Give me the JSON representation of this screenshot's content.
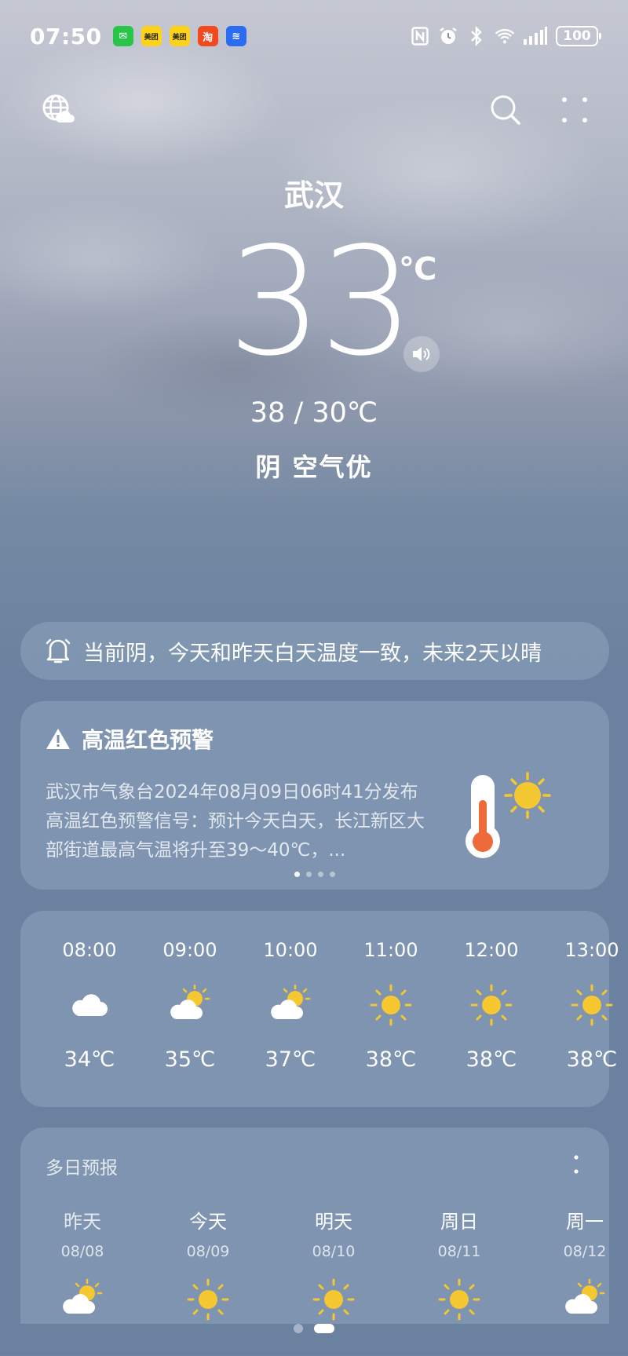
{
  "status": {
    "time": "07:50",
    "battery": "100",
    "apps": [
      {
        "name": "wechat",
        "label": "✉"
      },
      {
        "name": "meituan",
        "label": "美团"
      },
      {
        "name": "meituan-hotel",
        "label": "美团"
      },
      {
        "name": "taobao",
        "label": "淘"
      },
      {
        "name": "voice-assistant",
        "label": "≋"
      }
    ]
  },
  "weather": {
    "city": "武汉",
    "temperature": "33",
    "unit": "℃",
    "range": "38 / 30℃",
    "condition": "阴  空气优"
  },
  "notice": {
    "text": "当前阴，今天和昨天白天温度一致，未来2天以晴"
  },
  "alert": {
    "title": "高温红色预警",
    "body": "武汉市气象台2024年08月09日06时41分发布高温红色预警信号：预计今天白天，长江新区大部街道最高气温将升至39～40℃，...",
    "page_count": 4,
    "active_page": 1
  },
  "hourly": [
    {
      "time": "08:00",
      "icon": "cloudy-icon",
      "temp": "34℃"
    },
    {
      "time": "09:00",
      "icon": "partly-sunny-icon",
      "temp": "35℃"
    },
    {
      "time": "10:00",
      "icon": "partly-sunny-icon",
      "temp": "37℃"
    },
    {
      "time": "11:00",
      "icon": "sunny-icon",
      "temp": "38℃"
    },
    {
      "time": "12:00",
      "icon": "sunny-icon",
      "temp": "38℃"
    },
    {
      "time": "13:00",
      "icon": "sunny-icon",
      "temp": "38℃"
    }
  ],
  "daily": {
    "title": "多日预报",
    "days": [
      {
        "name": "昨天",
        "date": "08/08",
        "icon": "partly-sunny-icon"
      },
      {
        "name": "今天",
        "date": "08/09",
        "icon": "sunny-icon"
      },
      {
        "name": "明天",
        "date": "08/10",
        "icon": "sunny-icon"
      },
      {
        "name": "周日",
        "date": "08/11",
        "icon": "sunny-icon"
      },
      {
        "name": "周一",
        "date": "08/12",
        "icon": "partly-sunny-icon"
      }
    ]
  },
  "colors": {
    "sun": "#f5c730",
    "alert_red": "#ee6a3a"
  }
}
